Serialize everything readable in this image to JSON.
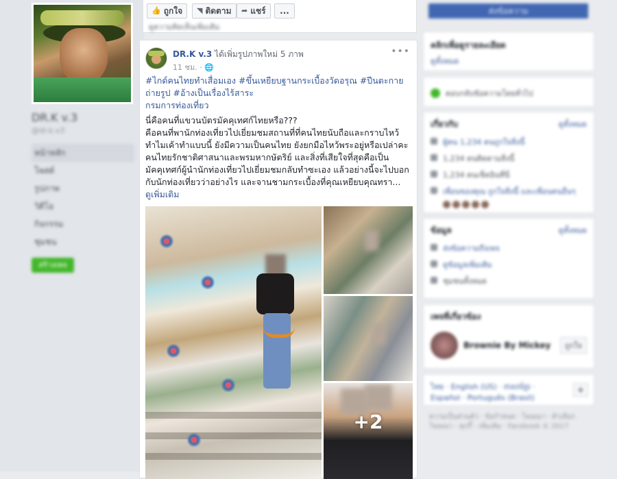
{
  "left": {
    "name": "DR.K v.3",
    "handle": "@dr.k.v3",
    "nav": [
      "หน้าหลัก",
      "โพสต์",
      "รูปภาพ",
      "วิดีโอ",
      "กิจกรรม",
      "ชุมชน"
    ],
    "create_label": "สร้างเพจ"
  },
  "topbar": {
    "like": "ถูกใจ",
    "follow": "ติดตาม",
    "share": "แชร์",
    "more": "...",
    "cut_text": "ดูความคิดเห็นเพิ่มเติม"
  },
  "post": {
    "author": "DR.K v.3",
    "action": "ได้เพิ่มรูปภาพใหม่ 5 ภาพ",
    "time": "11 ชม.",
    "tags": "#ไกด์คนไทยทำเสื่อมเอง #ขึ้นเหยียบฐานกระเบื้องวัดอรุณ #ปีนตะกายถ่ายรูป #อ้างเป็นเรื่องไร้สาระ",
    "tag_link": "กรมการท่องเที่ยว",
    "lines": [
      "นี่คือคนที่แขวนบัตรมัคคุเทศก์ไทยหรือ???",
      "คือคนที่พานักท่องเที่ยวไปเยี่ยมชมสถานที่ที่คนไทยนับถือและกราบไหว้",
      "ทำไมเค้าทำแบบนี้ ยังมีความเป็นคนไทย ยังยกมือไหว้พระอยู่หรือเปล่าคะ",
      "คนไทยรักชาติศาสนาและพรมหากษัตริย์ และสิ่งที่เสียใจที่สุดคือเป็น",
      "มัคคุเทศก์ผู้นำนักท่องเที่ยวไปเยี่ยมชมกลับทำซะเอง แล้วอย่างนี้จะไปบอก",
      "กับนักท่องเที่ยวว่าอย่างไร และจานชามกระเบื้องที่คุณเหยียบคุณทรา..."
    ],
    "see_more": "ดูเพิ่มเติม",
    "plus_count": "+2"
  },
  "right": {
    "top_button": "ส่งข้อความ",
    "card1_title": "คลิกเพื่อดูรายละเอียด",
    "card1_sub": "ดูทั้งหมด",
    "card2_text": "ตอบกลับข้อความโดยทั่วไป",
    "about_title": "เกี่ยวกับ",
    "about_link": "ดูทั้งหมด",
    "about_items": [
      "ผู้คน 1,234 คนถูกใจสิ่งนี้",
      "1,234 คนติดตามสิ่งนี้",
      "1,234 คนเช็คอินที่นี่",
      "เพื่อนของคุณ ถูกใจสิ่งนี้ และเพื่อนคนอื่นๆ"
    ],
    "info_title": "ข้อมูล",
    "info_link": "ดูทั้งหมด",
    "info_items": [
      "ส่งข้อความถึงเพจ",
      "ดูข้อมูลเพิ่มเติม",
      "ชุมชนทั้งหมด"
    ],
    "related_title": "เพจที่เกี่ยวข้อง",
    "related_name": "Brownie By Mickey",
    "related_btn": "ถูกใจ",
    "langs": "ไทย · English (US) · ភាសាខ្មែរ · Español · Português (Brasil)",
    "footer": "ความเป็นส่วนตัว · ข้อกำหนด · โฆษณา · ตัวเลือกโฆษณา · คุกกี้ · เพิ่มเติม · Facebook © 2017"
  }
}
